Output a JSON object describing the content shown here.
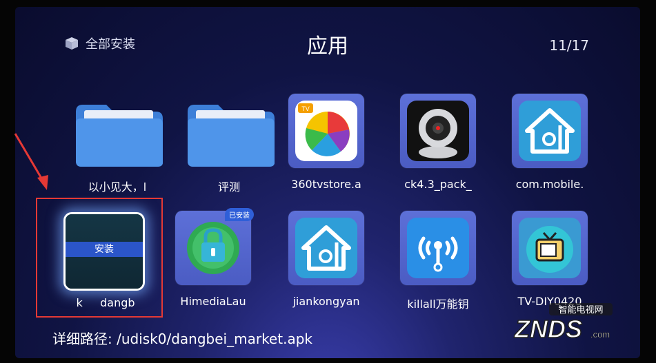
{
  "header": {
    "filter_label": "全部安装",
    "title": "应用",
    "page_indicator": "11/17"
  },
  "grid": {
    "row1": [
      {
        "label": "以小见大，l",
        "icon": "folder-icon"
      },
      {
        "label": "评测",
        "icon": "folder-icon"
      },
      {
        "label": "360tvstore.a",
        "icon": "360-tvstore-icon"
      },
      {
        "label": "ck4.3_pack_",
        "icon": "webcam-icon"
      },
      {
        "label": "com.mobile.",
        "icon": "home-camera-icon"
      }
    ],
    "row2": [
      {
        "label": "k     dangb",
        "icon": "dangbei-market-icon",
        "action": "安装"
      },
      {
        "label": "HimediaLau",
        "icon": "himedia-lock-icon",
        "badge": "已安装"
      },
      {
        "label": "jiankongyan",
        "icon": "home-camera-icon"
      },
      {
        "label": "killall万能钥",
        "icon": "wifi-key-icon"
      },
      {
        "label": "TV-DIY0420",
        "icon": "tv-icon"
      }
    ]
  },
  "footer": {
    "path_text": "详细路径: /udisk0/dangbei_market.apk"
  },
  "watermark": {
    "top_text": "智能电视网",
    "brand": "ZNDS",
    "suffix": ".com"
  },
  "colors": {
    "highlight_box": "#e53935",
    "install_bar": "#2b55c8",
    "tile_bg": "#5a6bd2"
  }
}
